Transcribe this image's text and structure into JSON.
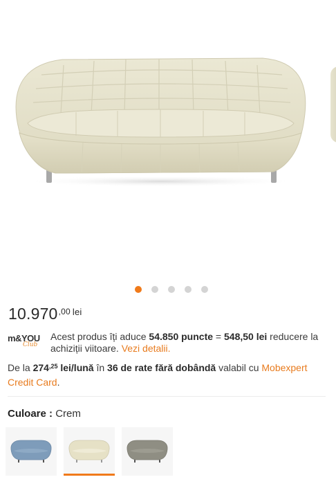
{
  "gallery": {
    "image": "sofa-crem-front-view",
    "slide_count": 5,
    "active_slide": 1
  },
  "price": {
    "integer": "10.970",
    "decimals": ",00",
    "currency": "lei"
  },
  "loyalty": {
    "logo_text": "m&YOU",
    "logo_sub": "Club",
    "text_before": "Acest produs îți aduce ",
    "points": "54.850 puncte",
    "equals": " = ",
    "discount": "548,50 lei",
    "text_after": " reducere la achiziții viitoare. ",
    "link": "Vezi detalii."
  },
  "credit": {
    "prefix": "De la ",
    "amount": "274",
    "amount_decimals": ",25",
    "unit": " lei/lună",
    "in": " în ",
    "installments": "36 de rate fără dobândă",
    "valid": " valabil cu ",
    "card": "Mobexpert Credit Card",
    "suffix": "."
  },
  "color": {
    "label": "Culoare",
    "separator": " : ",
    "value": "Crem"
  },
  "swatches": [
    {
      "name": "albastru",
      "color": "#7e9cba",
      "selected": false
    },
    {
      "name": "crem",
      "color": "#e6e1c6",
      "selected": true
    },
    {
      "name": "gri",
      "color": "#8f8e83",
      "selected": false
    }
  ],
  "colors": {
    "accent": "#f07a1a",
    "sofa": "#e9e6cf"
  }
}
